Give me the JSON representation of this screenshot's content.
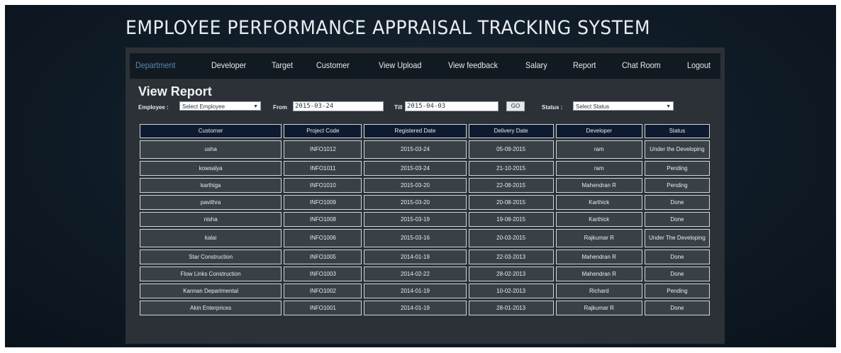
{
  "app_title": "EMPLOYEE PERFORMANCE APPRAISAL TRACKING SYSTEM",
  "nav": {
    "items": [
      {
        "label": "Department",
        "active": true
      },
      {
        "label": "Developer",
        "active": false
      },
      {
        "label": "Target",
        "active": false
      },
      {
        "label": "Customer",
        "active": false
      },
      {
        "label": "View Upload",
        "active": false
      },
      {
        "label": "View feedback",
        "active": false
      },
      {
        "label": "Salary",
        "active": false
      },
      {
        "label": "Report",
        "active": false
      },
      {
        "label": "Chat Room",
        "active": false
      },
      {
        "label": "Logout",
        "active": false
      }
    ]
  },
  "page_title": "View Report",
  "filters": {
    "employee_label": "Employee :",
    "employee_value": "Select Employee",
    "from_label": "From",
    "from_value": "2015-03-24",
    "till_label": "Till",
    "till_value": "2015-04-03",
    "go_label": "GO",
    "status_label": "Status :",
    "status_value": "Select Status"
  },
  "table": {
    "headers": [
      "Customer",
      "Project Code",
      "Registered Date",
      "Delivery Date",
      "Developer",
      "Status"
    ],
    "rows": [
      [
        "usha",
        "INFO1012",
        "2015-03-24",
        "05-09-2015",
        "ram",
        "Under the Developing"
      ],
      [
        "kowsalya",
        "INFO1011",
        "2015-03-24",
        "21-10-2015",
        "ram",
        "Pending"
      ],
      [
        "karthiga",
        "INFO1010",
        "2015-03-20",
        "22-08-2015",
        "Mahendran R",
        "Pending"
      ],
      [
        "pavithra",
        "INFO1009",
        "2015-03-20",
        "20-08-2015",
        "Karthick",
        "Done"
      ],
      [
        "nisha",
        "INFO1008",
        "2015-03-19",
        "19-08-2015",
        "Karthick",
        "Done"
      ],
      [
        "kalai",
        "INFO1006",
        "2015-03-16",
        "20-03-2015",
        "Rajkumar R",
        "Under The Developing"
      ],
      [
        "Star Construction",
        "INFO1005",
        "2014-01-19",
        "22-03-2013",
        "Mahendran R",
        "Done"
      ],
      [
        "Flow Links Construction",
        "INFO1003",
        "2014-02-22",
        "28-02-2013",
        "Mahendran R",
        "Done"
      ],
      [
        "Kannan Departmental",
        "INFO1002",
        "2014-01-19",
        "10-02-2013",
        "Richard",
        "Pending"
      ],
      [
        "Akin Enterprices",
        "INFO1001",
        "2014-01-19",
        "28-01-2013",
        "Rajkumar R",
        "Done"
      ]
    ]
  },
  "colors": {
    "background": "#0f1b26",
    "panel": "#2b3136",
    "nav_bar": "#121a21",
    "nav_active": "#5b86b0",
    "table_header": "#0d1a30",
    "table_cell": "#3a4146"
  }
}
